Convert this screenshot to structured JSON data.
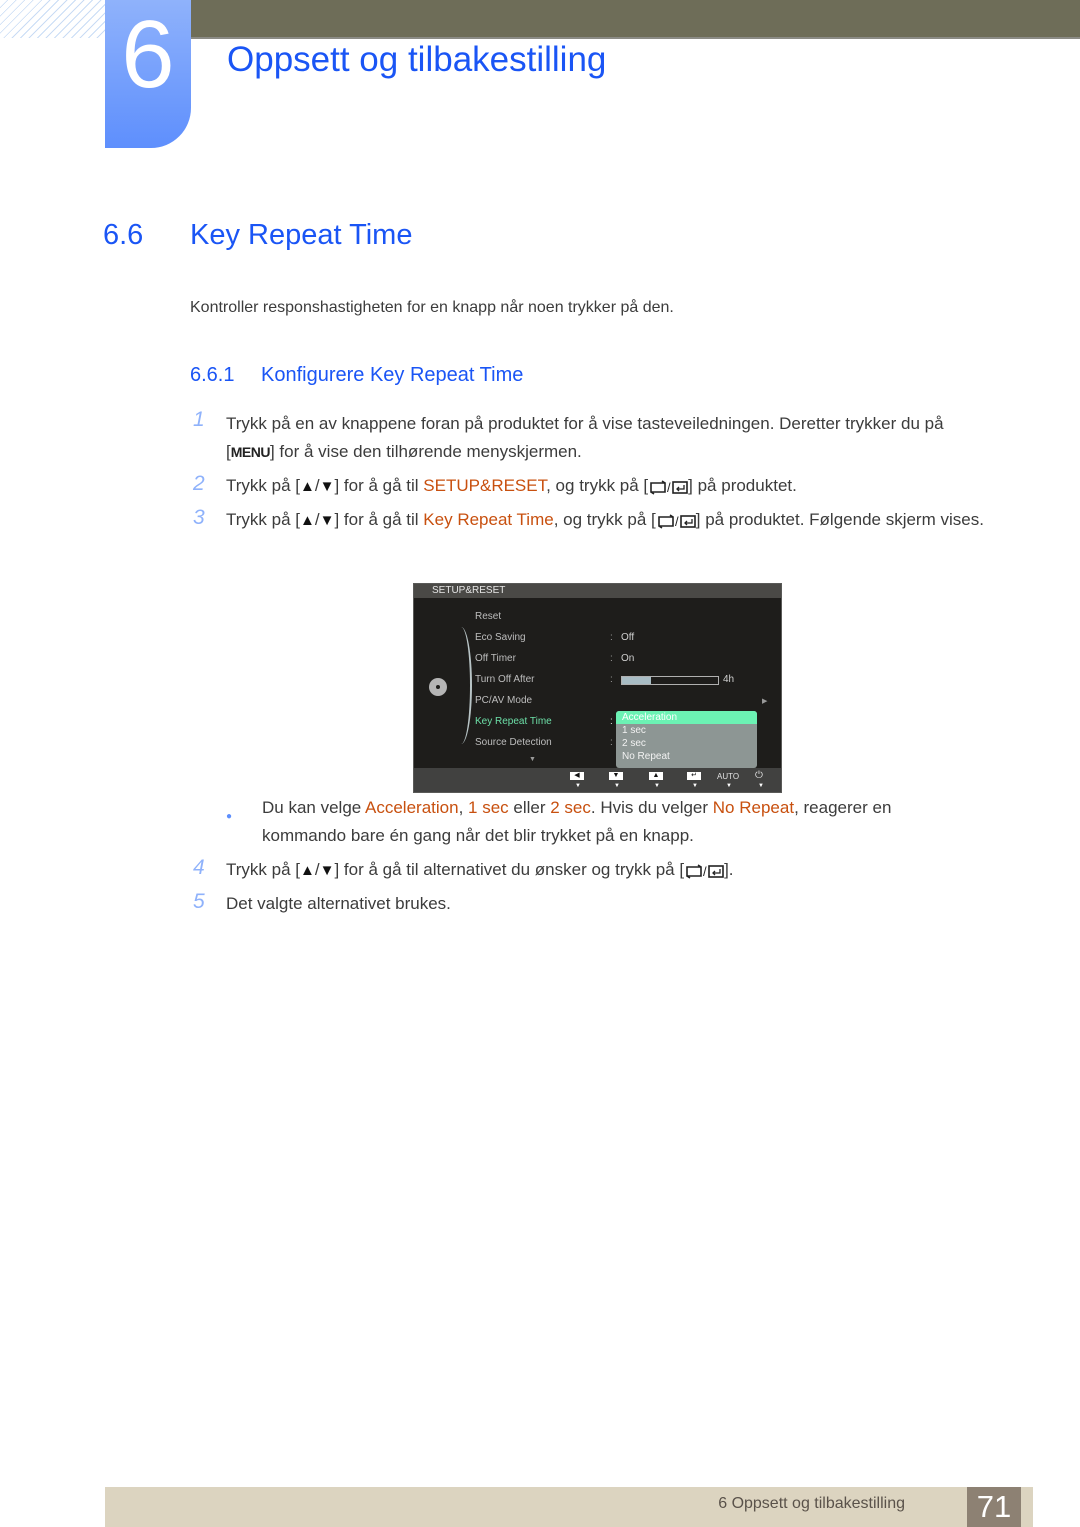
{
  "header": {
    "chapter_number": "6",
    "chapter_title": "Oppsett og tilbakestilling"
  },
  "section": {
    "number": "6.6",
    "title": "Key Repeat Time",
    "intro": "Kontroller responshastigheten for en knapp når noen trykker på den."
  },
  "subsection": {
    "number": "6.6.1",
    "title": "Konfigurere Key Repeat Time"
  },
  "steps": [
    {
      "num": "1",
      "text_a": "Trykk på en av knappene foran på produktet for å vise tasteveiledningen. Deretter trykker du på",
      "menu_key": "MENU",
      "text_b": "for å vise den tilhørende menyskjermen."
    },
    {
      "num": "2",
      "text_a": "Trykk på [",
      "up": "▲",
      "slash": "/",
      "down": "▼",
      "text_b": "] for å gå til",
      "highlight": "SETUP&RESET",
      "text_c": ", og trykk på [",
      "text_d": "] på produktet."
    },
    {
      "num": "3",
      "text_a": "Trykk på [",
      "up": "▲",
      "slash": "/",
      "down": "▼",
      "text_b": "] for å gå til",
      "highlight": "Key Repeat Time",
      "text_c": ", og trykk på [",
      "text_d": "] på produktet. Følgende skjerm vises."
    },
    {
      "num": "4",
      "text_a": "Trykk på [",
      "up": "▲",
      "slash": "/",
      "down": "▼",
      "text_b": "] for å gå til alternativet du ønsker og trykk på [",
      "text_d": "]."
    },
    {
      "num": "5",
      "text_a": "Det valgte alternativet brukes."
    }
  ],
  "note": {
    "t1": "Du kan velge ",
    "h1": "Acceleration",
    "t2": ", ",
    "h2": "1 sec",
    "t3": " eller ",
    "h3": "2 sec",
    "t4": ". Hvis du velger ",
    "h4": "No Repeat",
    "t5": ", reagerer en kommando bare én gang når det blir trykket på en knapp."
  },
  "osd": {
    "title": "SETUP&RESET",
    "items": [
      {
        "label": "Reset"
      },
      {
        "label": "Eco Saving",
        "value": "Off"
      },
      {
        "label": "Off Timer",
        "value": "On"
      },
      {
        "label": "Turn Off After",
        "value": "4h",
        "progress": 0.3
      },
      {
        "label": "PC/AV Mode"
      },
      {
        "label": "Key Repeat Time",
        "active": true
      },
      {
        "label": "Source Detection"
      }
    ],
    "colon": ":",
    "dropdown_options": [
      "Acceleration",
      "1 sec",
      "2 sec",
      "No Repeat"
    ],
    "dropdown_selected": "Acceleration",
    "footer_buttons": [
      "left-arrow",
      "down-arrow",
      "up-arrow",
      "enter",
      "AUTO",
      "power"
    ],
    "auto_label": "AUTO"
  },
  "footer": {
    "text": "6 Oppsett og tilbakestilling",
    "page": "71"
  },
  "colors": {
    "accent_blue": "#1a55f5",
    "highlight_orange": "#c8500f",
    "osd_active_green": "#6de0a8"
  }
}
